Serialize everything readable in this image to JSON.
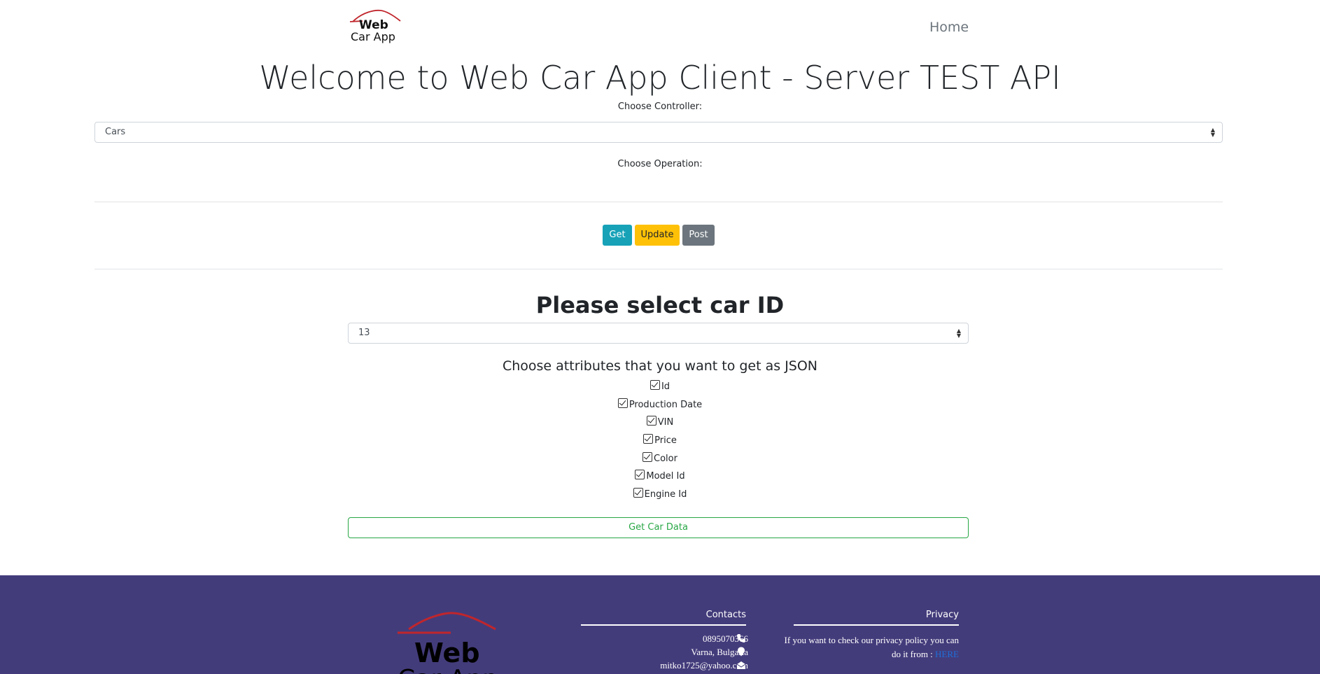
{
  "brand": {
    "line1": "Web",
    "line2": "Car App"
  },
  "nav": {
    "home": "Home"
  },
  "title": "Welcome to Web Car App Client - Server TEST API",
  "controller": {
    "label": "Choose Controller:",
    "selected": "Cars"
  },
  "operation": {
    "label": "Choose Operation:"
  },
  "operations": {
    "get": "Get",
    "update": "Update",
    "post": "Post"
  },
  "car_select": {
    "heading": "Please select car ID",
    "selected": "13"
  },
  "attributes": {
    "heading": "Choose attributes that you want to get as JSON",
    "items": [
      {
        "label": "Id",
        "checked": true
      },
      {
        "label": "Production Date",
        "checked": true
      },
      {
        "label": "VIN",
        "checked": true
      },
      {
        "label": "Price",
        "checked": true
      },
      {
        "label": "Color",
        "checked": true
      },
      {
        "label": "Model Id",
        "checked": true
      },
      {
        "label": "Engine Id",
        "checked": true
      }
    ]
  },
  "submit": "Get Car Data",
  "footer": {
    "contacts": {
      "heading": "Contacts",
      "phone": "0895070366",
      "location": "Varna, Bulgaria",
      "email": "mitko1725@yahoo.com"
    },
    "privacy": {
      "heading": "Privacy",
      "text": "If you want to check our privacy policy you can do it from : ",
      "link": "HERE"
    }
  },
  "colors": {
    "footer_bg": "#433c7b",
    "logo_red": "#c0262c",
    "get": "#17a2b8",
    "update": "#ffc107",
    "post": "#6c757d",
    "submit": "#28a745"
  },
  "icons": {
    "phone": "phone-icon",
    "location": "map-marker-icon",
    "email": "envelope-icon",
    "select": "select-caret-icon"
  }
}
